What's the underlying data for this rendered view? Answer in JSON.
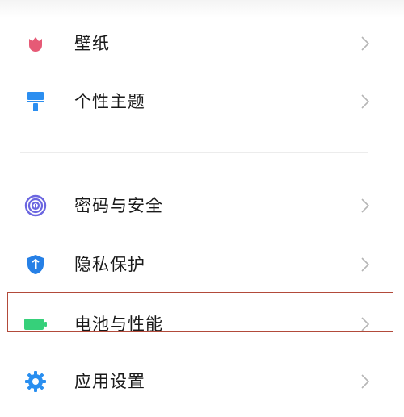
{
  "settings": {
    "items": [
      {
        "label": "壁纸",
        "icon": "tulip-icon",
        "color": "#e65a76"
      },
      {
        "label": "个性主题",
        "icon": "paint-brush-icon",
        "color": "#2b8ef0"
      },
      {
        "label": "密码与安全",
        "icon": "fingerprint-icon",
        "color": "#6b66e0"
      },
      {
        "label": "隐私保护",
        "icon": "privacy-shield-icon",
        "color": "#2680e6"
      },
      {
        "label": "电池与性能",
        "icon": "battery-icon",
        "color": "#36d07a"
      },
      {
        "label": "应用设置",
        "icon": "gear-icon",
        "color": "#2a8ff0"
      }
    ]
  },
  "highlight": {
    "color": "#b24a3a"
  }
}
